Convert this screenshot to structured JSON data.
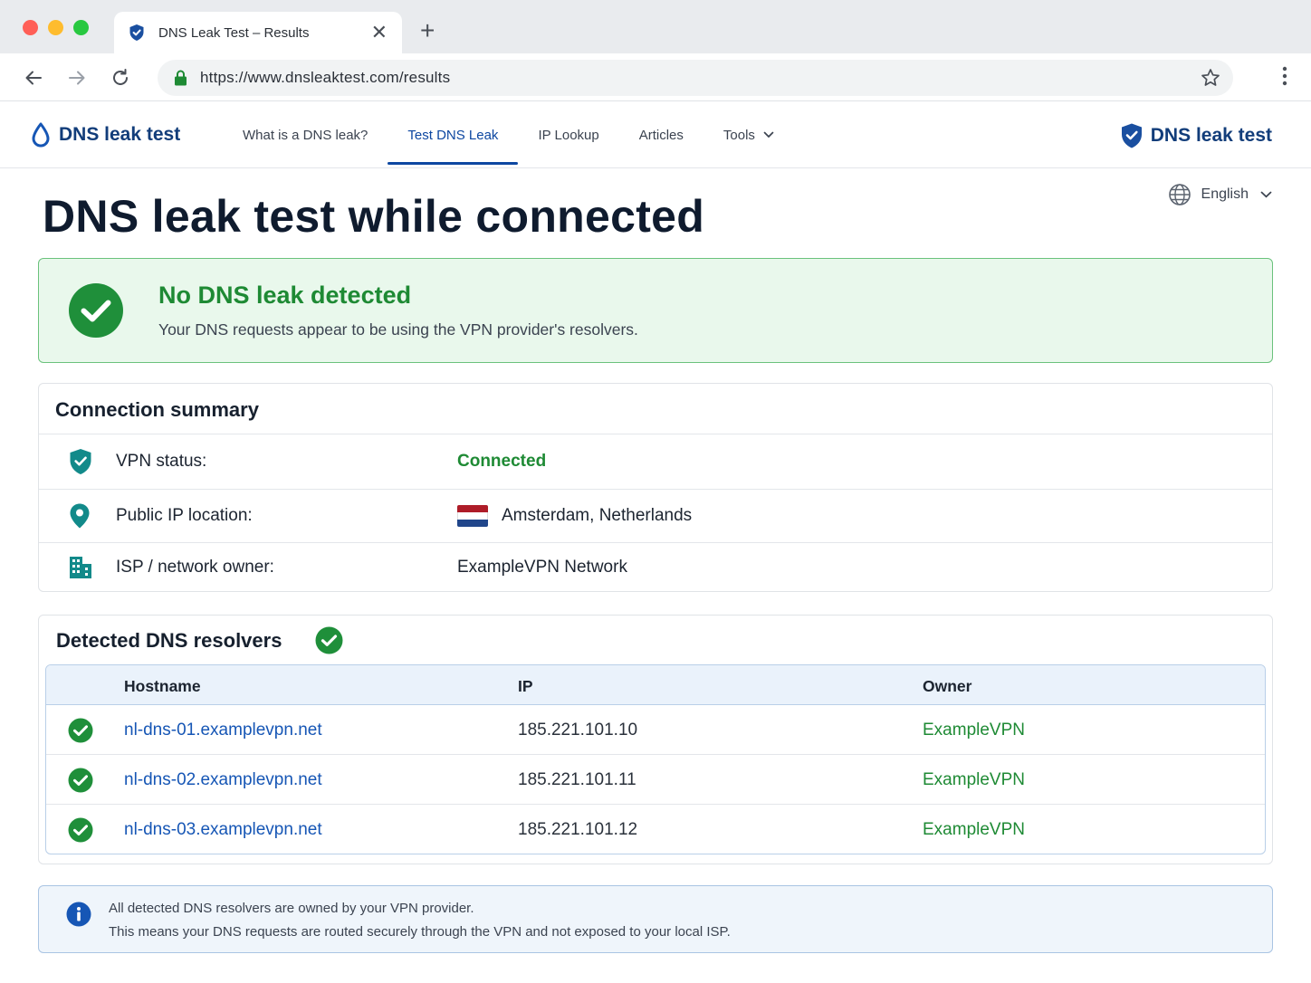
{
  "browser": {
    "tab_title": "DNS Leak Test – Results",
    "url": "https://www.dnsleaktest.com/results",
    "traffic_light_colors": [
      "#ff5f57",
      "#febc2e",
      "#28c840"
    ]
  },
  "header": {
    "brand": "DNS leak test",
    "brand_right": "DNS leak test",
    "nav": [
      {
        "label": "What is a DNS leak?",
        "active": false
      },
      {
        "label": "Test DNS Leak",
        "active": true
      },
      {
        "label": "IP Lookup",
        "active": false
      },
      {
        "label": "Articles",
        "active": false
      },
      {
        "label": "Tools",
        "active": false,
        "dropdown": true
      }
    ]
  },
  "language": {
    "selected": "English"
  },
  "page": {
    "title": "DNS leak test while connected"
  },
  "result": {
    "status": "success",
    "title": "No DNS leak detected",
    "description": "Your DNS requests appear to be using the VPN provider's resolvers."
  },
  "summary": {
    "title": "Connection summary",
    "rows": [
      {
        "icon": "shield-check-icon",
        "label": "VPN status:",
        "value": "Connected"
      },
      {
        "icon": "location-pin-icon",
        "label": "Public IP location:",
        "value": "Amsterdam, Netherlands"
      },
      {
        "icon": "building-icon",
        "label": "ISP / network owner:",
        "value": "ExampleVPN Network"
      }
    ]
  },
  "resolvers": {
    "title": "Detected DNS resolvers",
    "columns": [
      "Hostname",
      "IP",
      "Owner"
    ],
    "rows": [
      {
        "hostname": "nl-dns-01.examplevpn.net",
        "ip": "185.221.101.10",
        "owner": "ExampleVPN"
      },
      {
        "hostname": "nl-dns-02.examplevpn.net",
        "ip": "185.221.101.11",
        "owner": "ExampleVPN"
      },
      {
        "hostname": "nl-dns-03.examplevpn.net",
        "ip": "185.221.101.12",
        "owner": "ExampleVPN"
      }
    ]
  },
  "info": {
    "line1": "All detected DNS resolvers are owned by your VPN provider.",
    "line2": "This means your DNS requests are routed securely through the VPN and not exposed to your local ISP."
  },
  "colors": {
    "brand_blue": "#123d7a",
    "link_blue": "#1656b5",
    "success_green": "#1e8a34",
    "success_bg": "#e9f8ec",
    "info_bg": "#eff5fb",
    "flag_colors": [
      "#ae1c28",
      "#ffffff",
      "#21468b"
    ]
  }
}
